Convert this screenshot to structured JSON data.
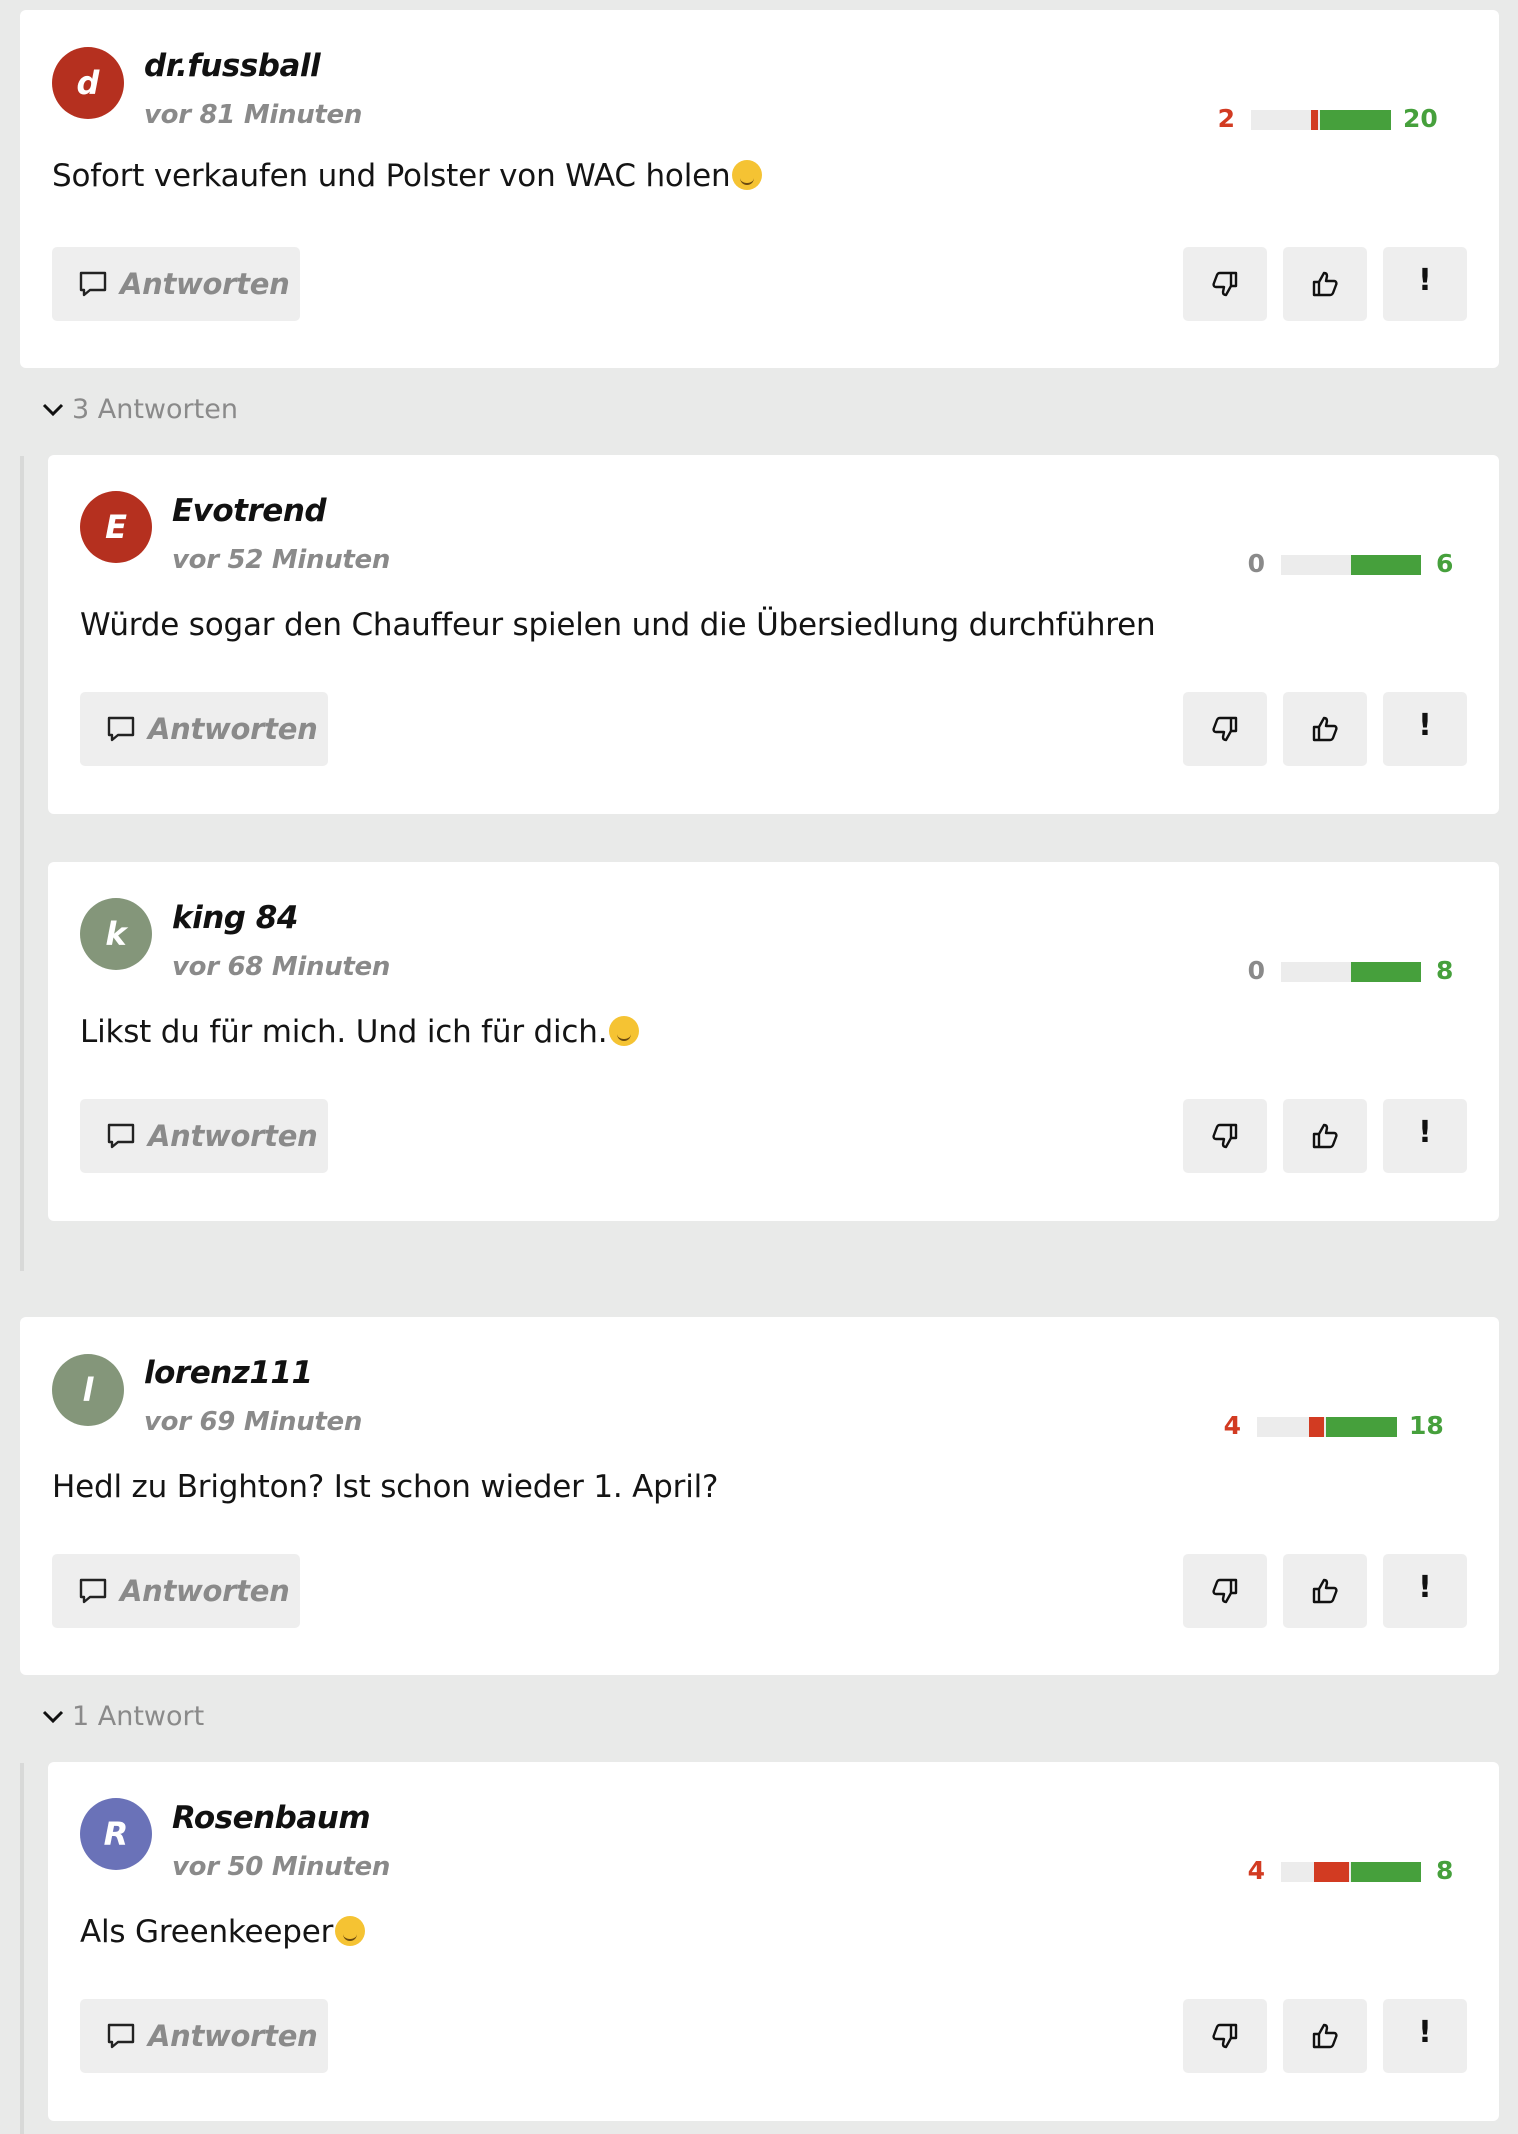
{
  "colors": {
    "negative": "#d23b22",
    "positive": "#46a03c",
    "neutral": "#8a8a8a"
  },
  "actions": {
    "reply_label": "Antworten",
    "report_label": "!"
  },
  "comments": [
    {
      "username": "dr.fussball",
      "initial": "d",
      "avatar_color": "#b5301f",
      "time": "vor 81 Minuten",
      "text": "Sofort verkaufen und Polster von WAC holen",
      "emoji": "slightly-smiling-face",
      "down_votes": "2",
      "up_votes": "20",
      "replies_toggle": "3 Antworten",
      "replies": [
        {
          "username": "Evotrend",
          "initial": "E",
          "avatar_color": "#b5301f",
          "time": "vor 52 Minuten",
          "text": "Würde sogar den Chauffeur spielen und die Übersiedlung durchführen",
          "down_votes": "0",
          "up_votes": "6"
        },
        {
          "username": "king 84",
          "initial": "k",
          "avatar_color": "#84967a",
          "time": "vor 68 Minuten",
          "text": "Likst du für mich. Und ich für dich.",
          "emoji": "kissing-face",
          "down_votes": "0",
          "up_votes": "8"
        }
      ]
    },
    {
      "username": "lorenz111",
      "initial": "l",
      "avatar_color": "#84967a",
      "time": "vor 69 Minuten",
      "text": "Hedl zu Brighton? Ist schon wieder 1. April?",
      "down_votes": "4",
      "up_votes": "18",
      "replies_toggle": "1 Antwort",
      "replies": [
        {
          "username": "Rosenbaum",
          "initial": "R",
          "avatar_color": "#6a72b8",
          "time": "vor 50 Minuten",
          "text": "Als Greenkeeper",
          "emoji": "grinning-sweat-face",
          "down_votes": "4",
          "up_votes": "8"
        }
      ]
    }
  ]
}
